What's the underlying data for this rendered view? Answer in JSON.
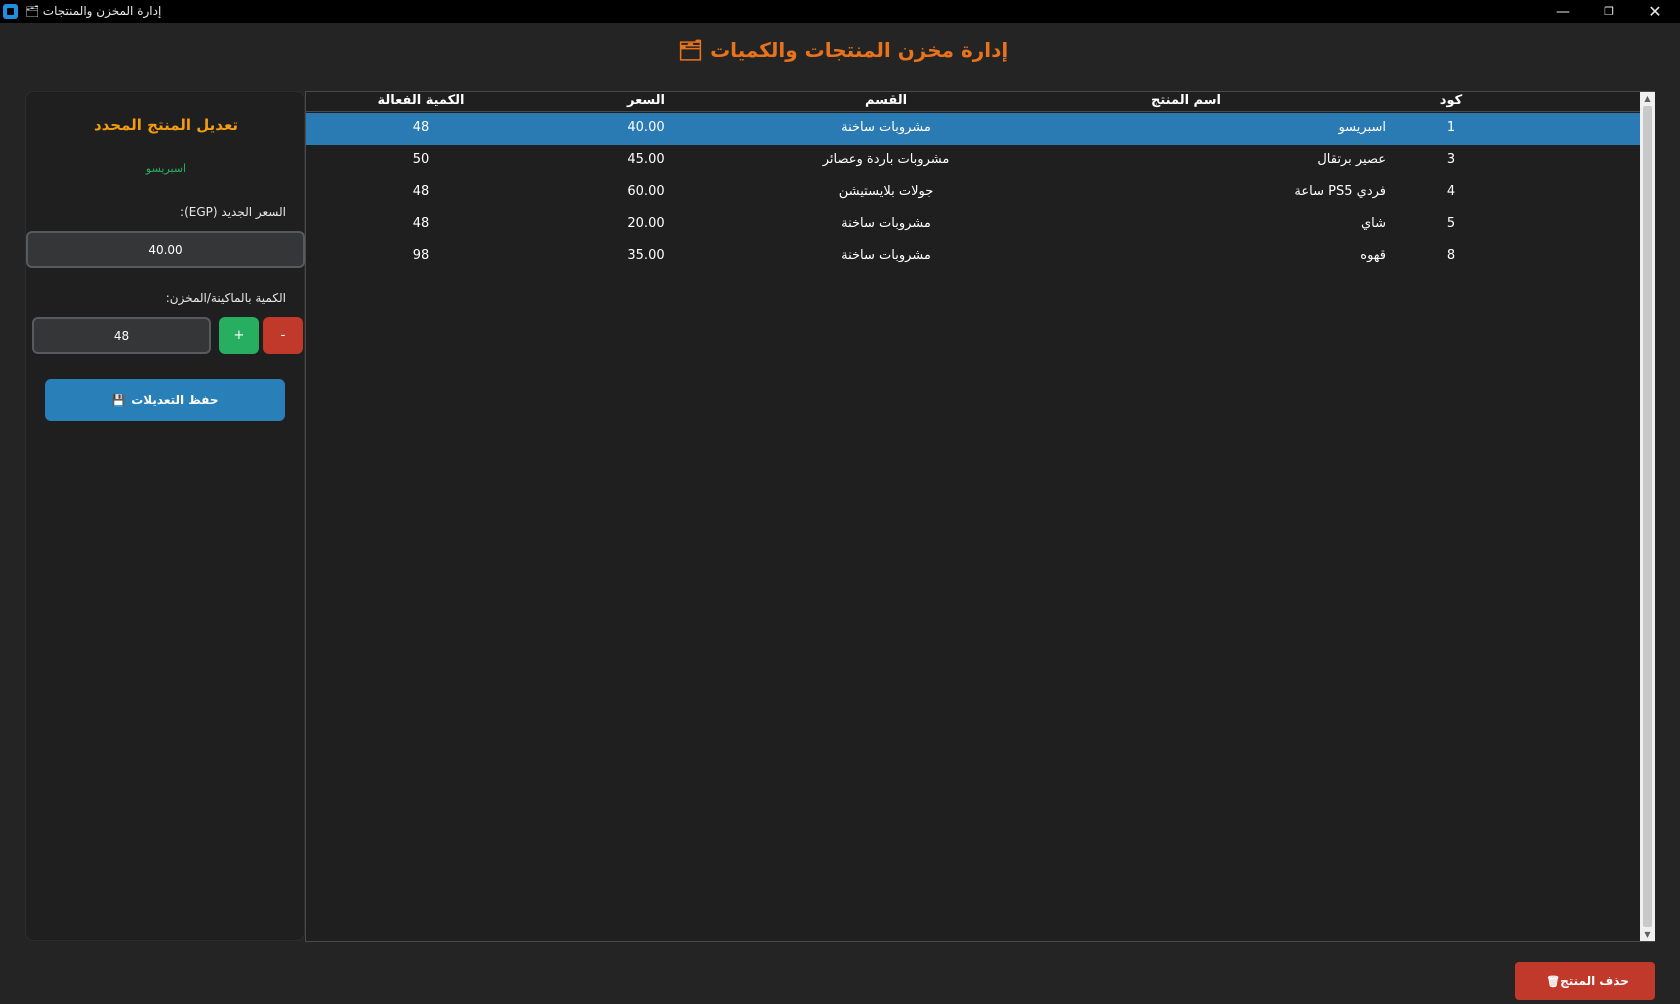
{
  "window": {
    "title": "إدارة المخزن والمنتجات",
    "title_icon": "🗂",
    "minimize_glyph": "—",
    "maximize_glyph": "❐",
    "close_glyph": "✕"
  },
  "header": {
    "title": "إدارة مخزن المنتجات والكميات",
    "icon": "🗂"
  },
  "edit_panel": {
    "title": "تعديل المنتج المحدد",
    "selected_product": "اسبريسو",
    "price_label": "السعر الجديد (EGP):",
    "price_value": "40.00",
    "quantity_label": "الكمية بالماكينة/المخزن:",
    "quantity_value": "48",
    "plus_label": "+",
    "minus_label": "-",
    "save_label": "حفظ التعديلات",
    "save_icon": "💾"
  },
  "table": {
    "columns": {
      "code": "كود",
      "name": "اسم المنتج",
      "category": "القسم",
      "price": "السعر",
      "quantity": "الكمية الفعالة"
    },
    "rows": [
      {
        "code": "1",
        "name": "اسبريسو",
        "category": "مشروبات ساخنة",
        "price": "40.00",
        "quantity": "48",
        "selected": true
      },
      {
        "code": "3",
        "name": "عصير برتقال",
        "category": "مشروبات باردة وعصائر",
        "price": "45.00",
        "quantity": "50",
        "selected": false
      },
      {
        "code": "4",
        "name": "فردي PS5 ساعة",
        "category": "جولات بلايستيشن",
        "price": "60.00",
        "quantity": "48",
        "selected": false
      },
      {
        "code": "5",
        "name": "شاي",
        "category": "مشروبات ساخنة",
        "price": "20.00",
        "quantity": "48",
        "selected": false
      },
      {
        "code": "8",
        "name": "قهوه",
        "category": "مشروبات ساخنة",
        "price": "35.00",
        "quantity": "98",
        "selected": false
      }
    ]
  },
  "footer": {
    "delete_label": "حذف المنتج",
    "delete_icon": "🗑"
  },
  "colors": {
    "accent_orange": "#e8731c",
    "panel_title": "#f39c12",
    "selected_row": "#2a7ab4",
    "save_button": "#2980b9",
    "plus_button": "#27ae60",
    "minus_button": "#c0392b",
    "delete_button": "#c0392b"
  }
}
